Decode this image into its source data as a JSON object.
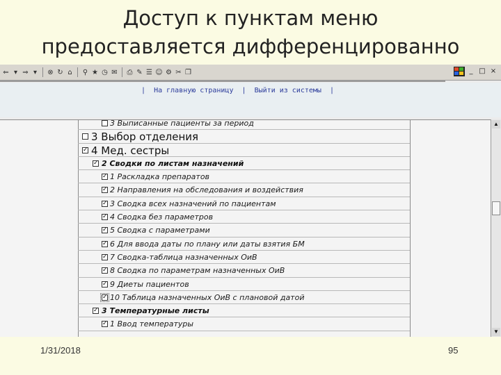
{
  "slide": {
    "title_line1": "Доступ к пунктам меню",
    "title_line2": "предоставляется дифференцированно",
    "date": "1/31/2018",
    "page_number": "95"
  },
  "toolbar": {
    "icons": [
      "back-icon",
      "dropdown-icon",
      "forward-icon",
      "dropdown-icon",
      "stop-icon",
      "refresh-icon",
      "home-icon",
      "search-icon",
      "favorites-icon",
      "history-icon",
      "mail-icon",
      "print-icon",
      "edit-icon",
      "discuss-icon",
      "messenger-icon",
      "tools-icon",
      "cut-icon",
      "copy-icon"
    ],
    "window_buttons": [
      "_",
      "□",
      "×"
    ]
  },
  "nav": {
    "sep": "|",
    "home_link": "На главную страницу",
    "logout_link": "Выйти из системы"
  },
  "menu_rows": [
    {
      "level": 2,
      "checked": false,
      "label": "3 Выписанные пациенты за период"
    },
    {
      "level": 0,
      "checked": false,
      "label": "3 Выбор отделения"
    },
    {
      "level": 0,
      "checked": true,
      "label": "4 Мед. сестры"
    },
    {
      "level": 1,
      "checked": true,
      "label": "2 Сводки по листам назначений"
    },
    {
      "level": 2,
      "checked": true,
      "label": "1 Раскладка препаратов"
    },
    {
      "level": 2,
      "checked": true,
      "label": "2 Направления на обследования и воздействия"
    },
    {
      "level": 2,
      "checked": true,
      "label": "3 Сводка всех назначений по пациентам"
    },
    {
      "level": 2,
      "checked": true,
      "label": "4 Сводка без параметров"
    },
    {
      "level": 2,
      "checked": true,
      "label": "5 Сводка с параметрами"
    },
    {
      "level": 2,
      "checked": true,
      "label": "6 Для ввода даты по плану или даты взятия БМ"
    },
    {
      "level": 2,
      "checked": true,
      "label": "7 Сводка-таблица назначенных ОиВ"
    },
    {
      "level": 2,
      "checked": true,
      "label": "8 Сводка по параметрам назначенных ОиВ"
    },
    {
      "level": 2,
      "checked": true,
      "label": "9 Диеты пациентов"
    },
    {
      "level": 2,
      "checked": true,
      "label": "10 Таблица назначенных ОиВ с плановой датой",
      "focus": true
    },
    {
      "level": 1,
      "checked": true,
      "label": "3 Температурные листы"
    },
    {
      "level": 2,
      "checked": true,
      "label": "1 Ввод температуры"
    }
  ],
  "checkbox_mark": "✓"
}
